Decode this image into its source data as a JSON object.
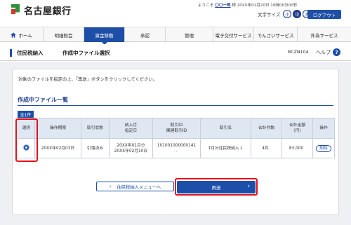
{
  "header": {
    "bank_name": "名古屋銀行",
    "user_prefix": "ようこそ",
    "user_name": "〇〇一郎",
    "user_suffix": "様 20XX年01月20日 10時00分00秒",
    "font_size_label": "文字サイズ",
    "font_sizes": [
      "小",
      "中",
      "大"
    ],
    "logout": "ログアウト"
  },
  "nav": {
    "items": [
      "ホーム",
      "明細照会",
      "資金移動",
      "承認",
      "管理",
      "電子交付サービス",
      "でんさいサービス",
      "外為サービス"
    ],
    "active_index": 2
  },
  "titlebar": {
    "main": "住民税納入",
    "sub": "作成中ファイル選択",
    "screen_id": "BCZN104",
    "help": "ヘルプ"
  },
  "content": {
    "instruction": "対象のファイルを指定の上、「再送」ボタンをクリックしてください。",
    "section_title": "作成中ファイル一覧",
    "count_tag": "全1件"
  },
  "table": {
    "headers": [
      "選択",
      "操作期限",
      "取引状態",
      "納入月\n指定日",
      "取引ID\n関連取引ID",
      "取引名",
      "合計件数",
      "合計金額\n（円）",
      "操作"
    ],
    "rows": [
      {
        "deadline": "20XX年02月03日",
        "status": "引落済み",
        "month": "20XX年01月分",
        "date": "20XX年02月10日",
        "trans_id": "101001000000141",
        "related_id": "–",
        "name": "1月分住民税納入１",
        "count": "4件",
        "amount": "83,000",
        "action": "削除"
      }
    ]
  },
  "buttons": {
    "back": "住民税納入メニューへ",
    "resend": "再送"
  },
  "colors": {
    "primary": "#1d4fa8",
    "highlight": "#e3121c",
    "header_cell": "#dfe7f3"
  }
}
